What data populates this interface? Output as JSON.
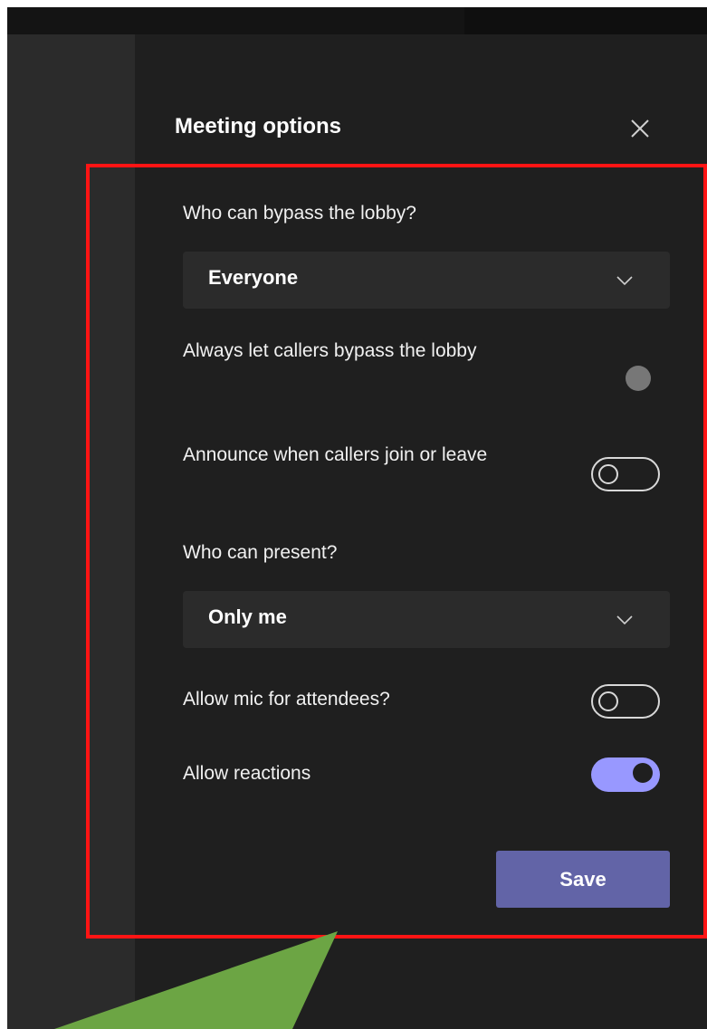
{
  "meeting_options": {
    "title": "Meeting options",
    "icons": {
      "close": "close-icon",
      "chevron": "chevron-down-icon",
      "highlight": "red-highlight-box",
      "annotation": "green-pointer-arrow"
    },
    "lobby": {
      "label": "Who can bypass the lobby?",
      "selected": "Everyone"
    },
    "callers_bypass": {
      "label": "Always let callers bypass the lobby",
      "enabled": false,
      "state": "unavailable"
    },
    "announce_callers": {
      "label": "Announce when callers join or leave",
      "enabled": false
    },
    "presenters": {
      "label": "Who can present?",
      "selected": "Only me"
    },
    "attendee_mic": {
      "label": "Allow mic for attendees?",
      "enabled": false
    },
    "reactions": {
      "label": "Allow reactions",
      "enabled": true
    },
    "save_label": "Save"
  },
  "colors": {
    "panel_bg": "#1f1f1f",
    "left_rail": "#2b2b2b",
    "control_bg": "#2b2b2b",
    "accent": "#6264a7",
    "toggle_on": "#9898ff",
    "highlight": "#ff1414",
    "arrow": "#6ca544"
  }
}
